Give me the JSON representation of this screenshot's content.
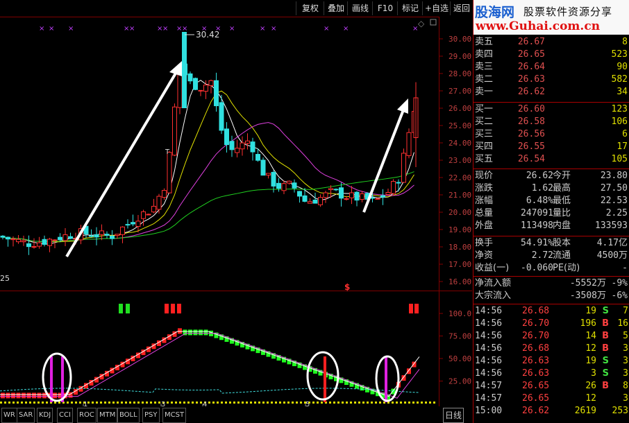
{
  "toolbar": {
    "buttons": [
      "复权",
      "叠加",
      "画线",
      "F10",
      "标记",
      "+自选",
      "返回"
    ]
  },
  "main_chart": {
    "y_ticks": [
      "30.00",
      "29.00",
      "28.00",
      "27.00",
      "26.00",
      "25.00",
      "24.00",
      "23.00",
      "22.00",
      "21.00",
      "20.00",
      "19.00",
      "18.00",
      "17.00",
      "16.00"
    ],
    "peak_label": "30.42",
    "low_label": "25",
    "marker_s": "$",
    "marker_t": "T"
  },
  "ind_chart": {
    "y_ticks": [
      "100.0",
      "75.00",
      "50.00",
      "25.00"
    ],
    "x_labels": [
      "1",
      "3",
      "4",
      "5"
    ]
  },
  "bottom": {
    "tabs": [
      "WR",
      "SAR",
      "KDJ",
      "CCI",
      "ROC",
      "MTM",
      "BOLL",
      "PSY",
      "MCST"
    ],
    "period": "日线"
  },
  "logo": {
    "title": "股海网",
    "subtitle": "股票软件资源分享",
    "url": "www.Guhai.com.cn"
  },
  "asks": [
    {
      "label": "卖五",
      "price": "26.67",
      "vol": "8"
    },
    {
      "label": "卖四",
      "price": "26.65",
      "vol": "523"
    },
    {
      "label": "卖三",
      "price": "26.64",
      "vol": "90"
    },
    {
      "label": "卖二",
      "price": "26.63",
      "vol": "582"
    },
    {
      "label": "卖一",
      "price": "26.62",
      "vol": "34"
    }
  ],
  "bids": [
    {
      "label": "买一",
      "price": "26.60",
      "vol": "123"
    },
    {
      "label": "买二",
      "price": "26.58",
      "vol": "106"
    },
    {
      "label": "买三",
      "price": "26.56",
      "vol": "6"
    },
    {
      "label": "买四",
      "price": "26.55",
      "vol": "17"
    },
    {
      "label": "买五",
      "price": "26.54",
      "vol": "105"
    }
  ],
  "quote": [
    {
      "l1": "现价",
      "v1": "26.62",
      "c1": "red",
      "l2": "今开",
      "v2": "23.80",
      "c2": "green"
    },
    {
      "l1": "涨跌",
      "v1": "1.62",
      "c1": "red",
      "l2": "最高",
      "v2": "27.50",
      "c2": "red"
    },
    {
      "l1": "涨幅",
      "v1": "6.48%",
      "c1": "red",
      "l2": "最低",
      "v2": "22.53",
      "c2": "green"
    },
    {
      "l1": "总量",
      "v1": "247091",
      "c1": "yellow",
      "l2": "量比",
      "v2": "2.25",
      "c2": "red"
    },
    {
      "l1": "外盘",
      "v1": "113498",
      "c1": "red",
      "l2": "内盘",
      "v2": "133593",
      "c2": "green"
    }
  ],
  "stats": [
    {
      "l1": "换手",
      "v1": "54.91%",
      "l2": "股本",
      "v2": "4.17亿"
    },
    {
      "l1": "净资",
      "v1": "2.72",
      "l2": "流通",
      "v2": "4500万"
    },
    {
      "l1": "收益(一)",
      "v1": "-0.060",
      "l2": "PE(动)",
      "v2": "-"
    }
  ],
  "flow": [
    {
      "label": "净流入额",
      "amount": "-5552万",
      "pct": "-9%"
    },
    {
      "label": "大宗流入",
      "amount": "-3508万",
      "pct": "-6%"
    }
  ],
  "ticks": [
    {
      "time": "14:56",
      "price": "26.68",
      "pc": "red",
      "vol": "19",
      "side": "S",
      "n": "7"
    },
    {
      "time": "14:56",
      "price": "26.70",
      "pc": "red",
      "vol": "196",
      "side": "B",
      "n": "16"
    },
    {
      "time": "14:56",
      "price": "26.70",
      "pc": "red",
      "vol": "14",
      "side": "B",
      "n": "5"
    },
    {
      "time": "14:56",
      "price": "26.68",
      "pc": "red",
      "vol": "12",
      "side": "B",
      "n": "3"
    },
    {
      "time": "14:56",
      "price": "26.63",
      "pc": "red",
      "vol": "19",
      "side": "S",
      "n": "3"
    },
    {
      "time": "14:56",
      "price": "26.63",
      "pc": "red",
      "vol": "3",
      "side": "S",
      "n": "3"
    },
    {
      "time": "14:57",
      "price": "26.65",
      "pc": "red",
      "vol": "26",
      "side": "B",
      "n": "8"
    },
    {
      "time": "14:57",
      "price": "26.65",
      "pc": "red",
      "vol": "12",
      "side": "",
      "n": "3"
    },
    {
      "time": "15:00",
      "price": "26.62",
      "pc": "red",
      "vol": "2619",
      "side": "",
      "n": "253"
    }
  ],
  "colors": {
    "up": "#ff3030",
    "down": "#30e0e0",
    "grid": "#800000",
    "green": "#20d020"
  }
}
